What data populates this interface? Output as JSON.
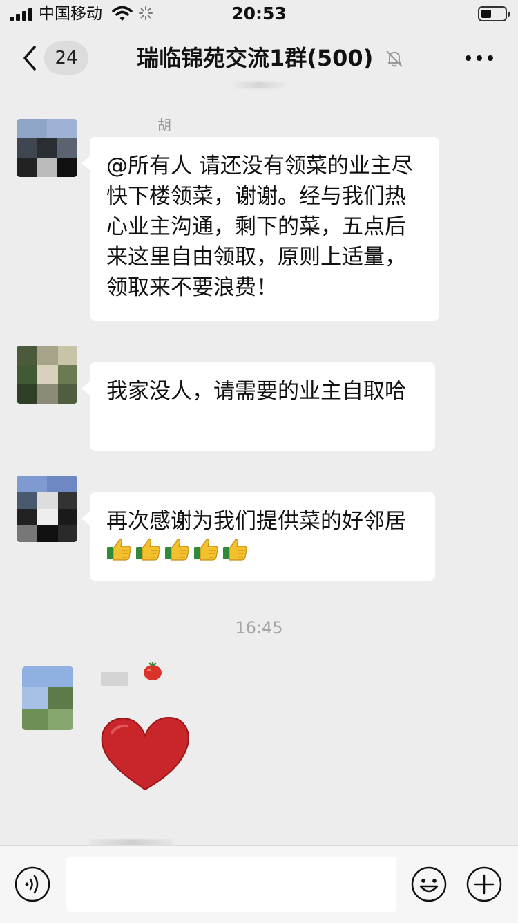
{
  "status_bar": {
    "carrier": "中国移动",
    "time": "20:53"
  },
  "header": {
    "unread_count": "24",
    "title": "瑞临锦苑交流1群(500)",
    "icons": [
      "back-chevron-icon",
      "mute-bell-icon",
      "more-icon"
    ]
  },
  "messages": [
    {
      "sender": "胡",
      "text": "@所有人 请还没有领菜的业主尽快下楼领菜，谢谢。经与我们热心业主沟通，剩下的菜，五点后来这里自由领取，原则上适量，领取来不要浪费！"
    },
    {
      "sender": "",
      "text": "我家没人，请需要的业主自取哈"
    },
    {
      "sender": "",
      "text": "再次感谢为我们提供菜的好邻居",
      "emoji": "thumbs-up-emoji",
      "emoji_count": 5
    }
  ],
  "timestamp": "16:45",
  "sticker": {
    "sender_emoji": "tomato-emoji",
    "type": "red-heart-sticker"
  },
  "input": {
    "placeholder": "",
    "icons": [
      "voice-icon",
      "emoji-icon",
      "plus-icon"
    ]
  },
  "colors": {
    "background": "#ededed",
    "bubble": "#ffffff",
    "heart": "#c9262b"
  }
}
